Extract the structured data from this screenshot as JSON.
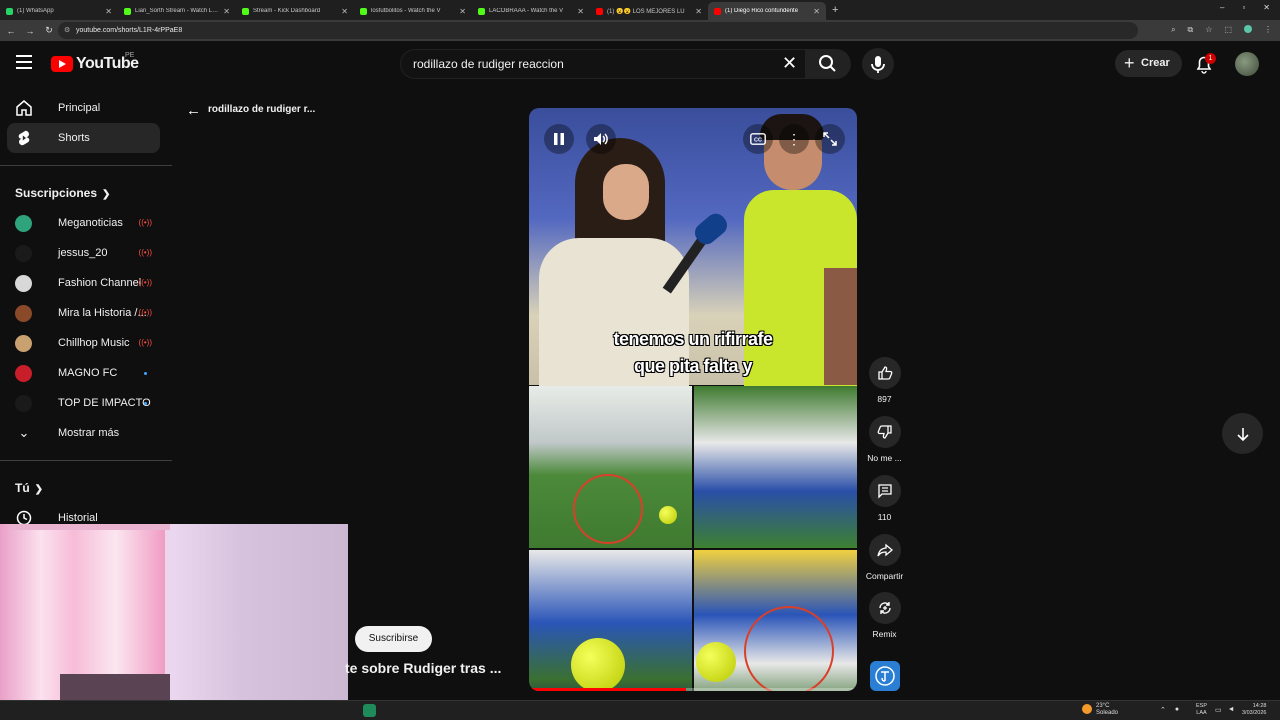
{
  "browser": {
    "tabs": [
      {
        "title": "(1) WhatsApp",
        "color": "#25d366",
        "active": false
      },
      {
        "title": "Lian_Sorth Stream - Watch Live",
        "color": "#53fc18",
        "active": false
      },
      {
        "title": "Stream - Kick Dashboard",
        "color": "#53fc18",
        "active": false
      },
      {
        "title": "losfutbolitos - Watch the V",
        "color": "#53fc18",
        "active": false
      },
      {
        "title": "LACOBRAAA - Watch the V",
        "color": "#53fc18",
        "active": false
      },
      {
        "title": "(1) 😮😮 LOS MEJORES LU",
        "color": "#ff0000",
        "active": false
      },
      {
        "title": "(1) Diego Rico contundente",
        "color": "#ff0000",
        "active": true
      }
    ],
    "url": "youtube.com/shorts/L1R-4rPPaE8"
  },
  "header": {
    "logo_text": "YouTube",
    "country_code": "PE",
    "search_value": "rodillazo de rudiger reaccion",
    "create_label": "Crear",
    "notification_count": "1"
  },
  "sidebar": {
    "nav": [
      {
        "label": "Principal",
        "icon": "home-icon"
      },
      {
        "label": "Shorts",
        "icon": "shorts-icon",
        "selected": true
      }
    ],
    "subs_heading": "Suscripciones",
    "subs": [
      {
        "label": "Meganoticias",
        "status": "live",
        "color": "#2fa37c"
      },
      {
        "label": "jessus_20",
        "status": "live",
        "color": "#1a1a1a"
      },
      {
        "label": "Fashion Channel",
        "status": "live",
        "color": "#d8d8d8"
      },
      {
        "label": "Mira la Historia /...",
        "status": "live",
        "color": "#8a4a2a"
      },
      {
        "label": "Chillhop Music",
        "status": "live",
        "color": "#c9a070"
      },
      {
        "label": "MAGNO FC",
        "status": "new",
        "color": "#c81e2a"
      },
      {
        "label": "TOP DE IMPACTO",
        "status": "new",
        "color": "#1a1a1a"
      }
    ],
    "show_more": "Mostrar más",
    "you_heading": "Tú",
    "history": "Historial"
  },
  "main": {
    "back_label": "rodillazo de rudiger r...",
    "caption_line1": "tenemos un rifirrafe",
    "caption_line2": "que pita falta y",
    "video_progress": 0.48,
    "subscribe_label": "Suscribirse",
    "video_title": "te sobre Rudiger tras ..."
  },
  "actions": {
    "likes": "897",
    "dislike_label": "No me ...",
    "comments": "110",
    "share_label": "Compartir",
    "remix_label": "Remix"
  },
  "taskbar": {
    "temperature": "23°C",
    "weather": "Soleado",
    "lang_top": "ESP",
    "lang_bottom": "LAA",
    "time": "14:28",
    "date": "3/03/2026"
  }
}
